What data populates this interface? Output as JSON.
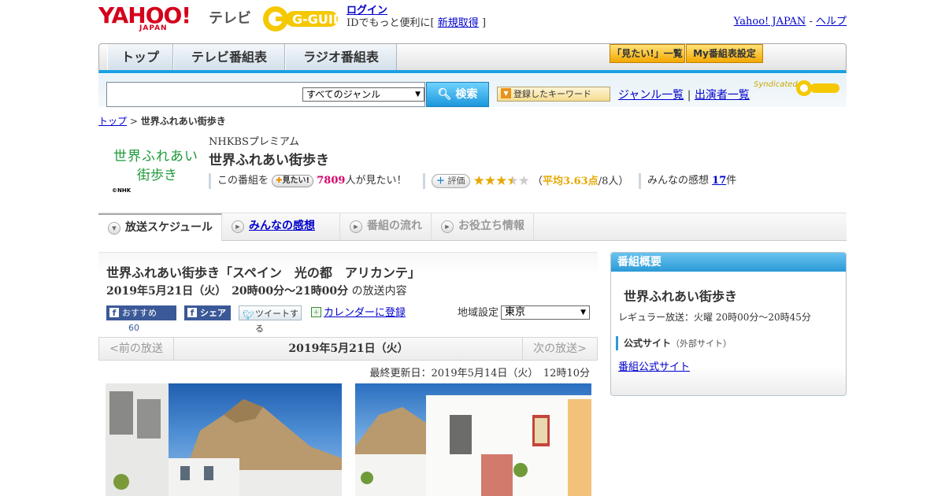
{
  "header": {
    "logo_text": "YAHOO!",
    "logo_sub": "JAPAN",
    "service_label": "テレビ",
    "guide_logo": "G-GUIDE",
    "login_label": "ログイン",
    "login_prompt_prefix": "IDでもっと便利に[",
    "register_label": "新規取得",
    "login_prompt_suffix": "]",
    "yahoo_japan_link": "Yahoo! JAPAN",
    "separator": "-",
    "help_link": "ヘルプ"
  },
  "nav": {
    "tabs": [
      {
        "label": "トップ"
      },
      {
        "label": "テレビ番組表"
      },
      {
        "label": "ラジオ番組表"
      }
    ],
    "watchlist_label": "「見たい!」一覧",
    "mytable_label": "My番組表設定"
  },
  "search": {
    "input_value": "",
    "genre_selected": "すべてのジャンル",
    "button_label": "検索",
    "keyword_button_label": "登録したキーワード",
    "genre_list_link": "ジャンル一覧",
    "link_separator": "|",
    "performer_list_link": "出演者一覧",
    "syndicated_label": "Syndicated"
  },
  "breadcrumb": {
    "home": "トップ",
    "separator": ">",
    "current": "世界ふれあい街歩き"
  },
  "program": {
    "logo_line1": "世界ふれあい",
    "logo_line2": "街歩き",
    "logo_copyright": "©NHK",
    "channel": "NHKBSプレミアム",
    "title": "世界ふれあい街歩き",
    "watch_prefix": "この番組を",
    "watch_button": "見たい!",
    "watch_count": "7809",
    "watch_suffix": "人が見たい！",
    "rate_button": "評価",
    "rating_value": 3.5,
    "rating_max": 5,
    "avg_prefix": "（",
    "avg_score": "平均3.63点",
    "avg_suffix": "/8人）",
    "impressions_prefix": "みんなの感想",
    "impressions_count": "17",
    "impressions_suffix": "件"
  },
  "content_tabs": [
    {
      "label": "放送スケジュール"
    },
    {
      "label": "みんなの感想"
    },
    {
      "label": "番組の流れ"
    },
    {
      "label": "お役立ち情報"
    }
  ],
  "episode": {
    "title": "世界ふれあい街歩き「スペイン　光の都　アリカンテ」",
    "datetime": "2019年5月21日（火）　20時00分～21時00分",
    "datetime_suffix": "の放送内容",
    "recommend_label": "おすすめ",
    "recommend_count": "60",
    "share_label": "シェア",
    "tweet_label": "ツイートする",
    "calendar_label": "カレンダーに登録",
    "region_label": "地域設定",
    "region_selected": "東京"
  },
  "date_nav": {
    "prev_label": "<前の放送",
    "current_date": "2019年5月21日（火）",
    "next_label": "次の放送>"
  },
  "last_updated": "最終更新日：2019年5月14日（火）　12時10分",
  "sidebar": {
    "header": "番組概要",
    "title": "世界ふれあい街歩き",
    "regular": "レギュラー放送：火曜 20時00分～20時45分",
    "official_label": "公式サイト",
    "official_note": "（外部サイト）",
    "official_link": "番組公式サイト"
  },
  "colors": {
    "yahoo_red": "#d4001c",
    "accent_blue": "#1ba1e2",
    "star_gold": "#e6a800",
    "count_pink": "#d6006a",
    "facebook_blue": "#3b5998"
  }
}
